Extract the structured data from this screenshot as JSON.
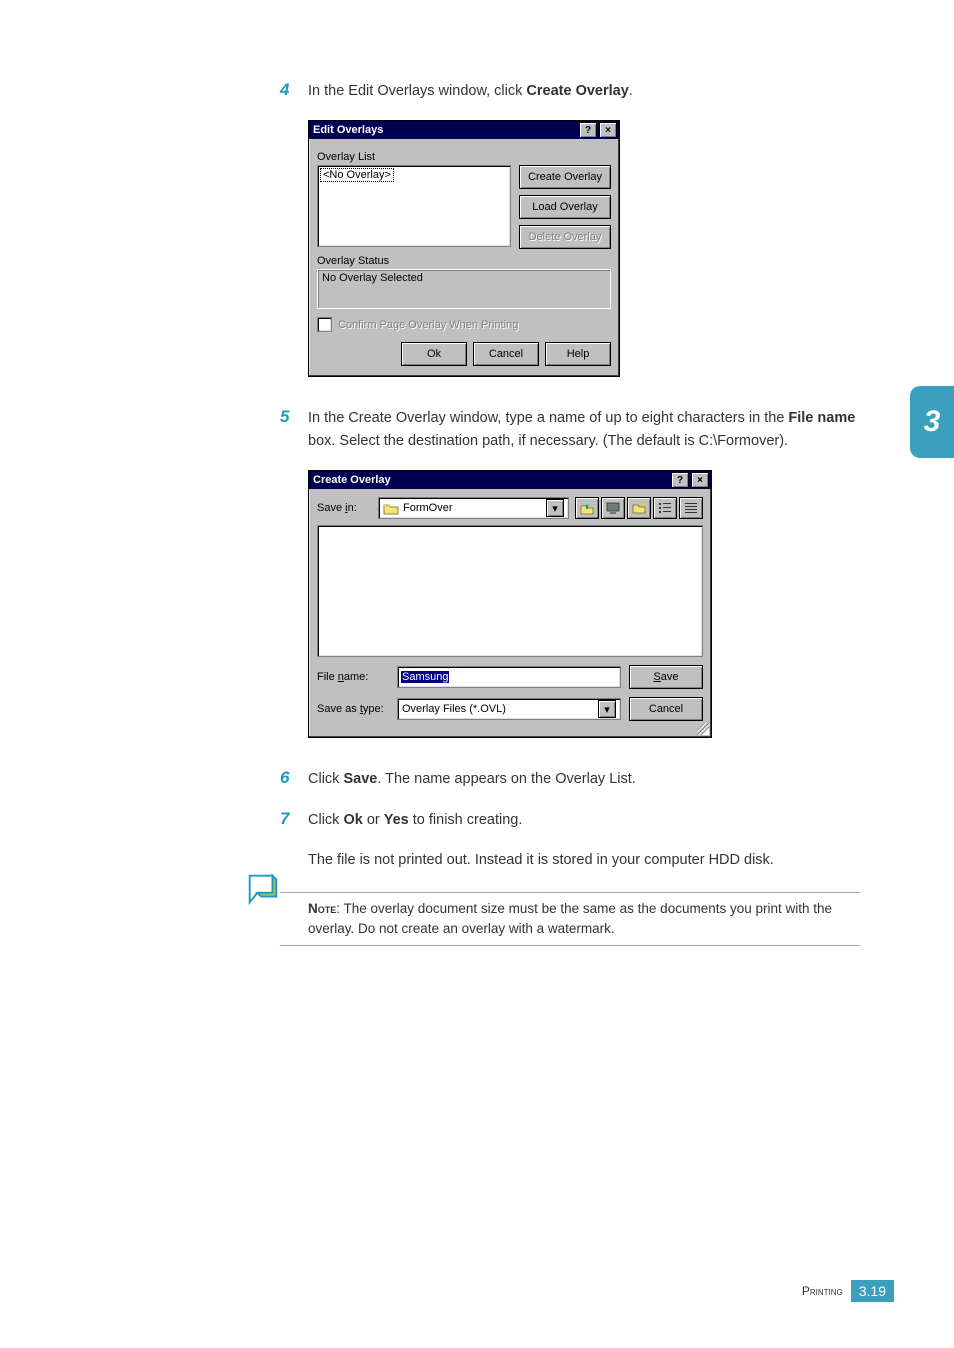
{
  "steps": {
    "s4": {
      "num": "4",
      "text_a": "In the Edit Overlays window, click ",
      "text_b": "Create Overlay",
      "text_c": "."
    },
    "s5": {
      "num": "5",
      "text_a": "In the Create Overlay window, type a name of up to eight characters in the ",
      "text_b": "File name",
      "text_c": " box. Select the destination path, if necessary. (The default is C:\\Formover)."
    },
    "s6": {
      "num": "6",
      "text_a": "Click ",
      "text_b": "Save",
      "text_c": ". The name appears on the Overlay List."
    },
    "s7": {
      "num": "7",
      "text_a": "Click ",
      "text_b": "Ok",
      "text_c": " or ",
      "text_d": "Yes",
      "text_e": " to finish creating."
    },
    "s7sub": "The file is not printed out. Instead it is stored in your computer HDD disk."
  },
  "edit_overlays": {
    "title": "Edit Overlays",
    "list_label": "Overlay List",
    "list_item": "<No Overlay>",
    "btn_create": "Create Overlay",
    "btn_load": "Load Overlay",
    "btn_delete": "Delete Overlay",
    "status_label": "Overlay Status",
    "status_text": "No Overlay Selected",
    "confirm_chk": "Confirm Page Overlay When Printing",
    "btn_ok": "Ok",
    "btn_cancel": "Cancel",
    "btn_help": "Help"
  },
  "create_overlay": {
    "title": "Create Overlay",
    "save_in_label": "Save in:",
    "folder": "FormOver",
    "file_name_label": "File name:",
    "file_name_value": "Samsung",
    "save_as_type_label": "Save as type:",
    "save_as_type_value": "Overlay Files (*.OVL)",
    "btn_save": "Save",
    "btn_cancel": "Cancel"
  },
  "note": {
    "label": "Note",
    "text": ": The overlay document size must be the same as the documents you print with the overlay. Do not create an overlay with a watermark."
  },
  "sidetab": "3",
  "footer": {
    "section": "Printing",
    "page": "3.19"
  },
  "glyphs": {
    "help": "?",
    "close": "×",
    "tri_down": "▾"
  }
}
